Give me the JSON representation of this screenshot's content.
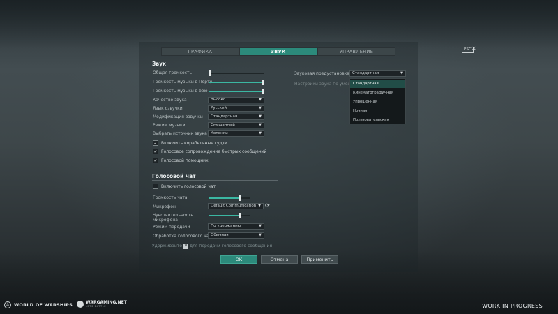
{
  "tabs": [
    {
      "label": "ГРАФИКА",
      "active": false
    },
    {
      "label": "ЗВУК",
      "active": true
    },
    {
      "label": "УПРАВЛЕНИЕ",
      "active": false
    }
  ],
  "esc_label": "ESC",
  "close_glyph": "✕",
  "sound": {
    "title": "Звук",
    "sliders": [
      {
        "label": "Общая громкость",
        "value": 0.0
      },
      {
        "label": "Громкость музыки в Порту",
        "value": 1.0
      },
      {
        "label": "Громкость музыки в бою",
        "value": 1.0
      }
    ],
    "dropdowns": [
      {
        "label": "Качество звука",
        "value": "Высоко"
      },
      {
        "label": "Язык озвучки",
        "value": "Русский"
      },
      {
        "label": "Модификация озвучки",
        "value": "Стандартная"
      },
      {
        "label": "Режим музыки",
        "value": "Смешанный"
      },
      {
        "label": "Выбрать источник звука",
        "value": "Колонки"
      }
    ],
    "checkboxes": [
      {
        "label": "Включить корабельные гудки",
        "checked": true
      },
      {
        "label": "Голосовое сопровождение быстрых сообщений",
        "checked": true
      },
      {
        "label": "Голосовой помощник",
        "checked": true
      }
    ],
    "preset": {
      "label": "Звуковая предустановка",
      "value": "Стандартная",
      "default_label": "Настройки звука по умолчанию",
      "options": [
        "Стандартная",
        "Кинематографичная",
        "Упрощённая",
        "Ночная",
        "Пользовательская"
      ]
    }
  },
  "voice": {
    "title": "Голосовой чат",
    "enable_label": "Включить голосовой чат",
    "enable_checked": false,
    "chat_volume_label": "Громкость чата",
    "chat_volume_value": 0.75,
    "mic_label": "Микрофон",
    "mic_value": "Default Communication Device",
    "sensitivity_label": "Чувствительность микрофона",
    "sensitivity_value": 0.75,
    "mode_label": "Режим передачи",
    "mode_value": "По удержанию",
    "processing_label": "Обработка голосового чата",
    "processing_value": "Обычная",
    "hint_before": "Удерживайте",
    "hint_key": "V",
    "hint_after": "для передачи голосового сообщения"
  },
  "buttons": {
    "ok": "ОК",
    "cancel": "Отмена",
    "apply": "Применить"
  },
  "footer": {
    "game_brand": "WORLD OF WARSHIPS",
    "publisher": "WARGAMING.NET",
    "publisher_sub": "LETS BATTLE",
    "wip": "WORK IN PROGRESS"
  },
  "colors": {
    "accent": "#2c8a7b",
    "slider_fill": "#3bb7a2",
    "background": "#3e474a"
  }
}
